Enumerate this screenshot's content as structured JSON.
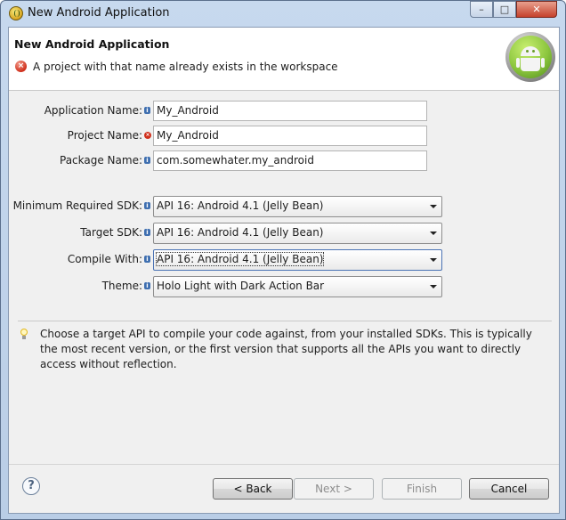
{
  "window": {
    "title": "New Android Application",
    "controls": {
      "minimize": "–",
      "maximize": "□",
      "close": "✕"
    }
  },
  "header": {
    "title": "New Android Application",
    "message": "A project with that name already exists in the workspace",
    "error_icon": "×"
  },
  "fields": {
    "app_name": {
      "label": "Application Name:",
      "value": "My_Android",
      "indicator": "info"
    },
    "project_name": {
      "label": "Project Name:",
      "value": "My_Android",
      "indicator": "error"
    },
    "package_name": {
      "label": "Package Name:",
      "value": "com.somewhater.my_android",
      "indicator": "info"
    }
  },
  "combos": {
    "min_sdk": {
      "label": "Minimum Required SDK:",
      "value": "API 16: Android 4.1 (Jelly Bean)"
    },
    "target_sdk": {
      "label": "Target SDK:",
      "value": "API 16: Android 4.1 (Jelly Bean)"
    },
    "compile_with": {
      "label": "Compile With:",
      "value": "API 16: Android 4.1 (Jelly Bean)"
    },
    "theme": {
      "label": "Theme:",
      "value": "Holo Light with Dark Action Bar"
    }
  },
  "hint": {
    "text": "Choose a target API to compile your code against, from your installed SDKs. This is typically the most recent version, or the first version that supports all the APIs you want to directly access without reflection."
  },
  "footer": {
    "help": "?",
    "back": "< Back",
    "next": "Next >",
    "finish": "Finish",
    "cancel": "Cancel"
  },
  "colors": {
    "error": "#d0301c",
    "info": "#3f6fb0",
    "android_green": "#8cc63e"
  }
}
